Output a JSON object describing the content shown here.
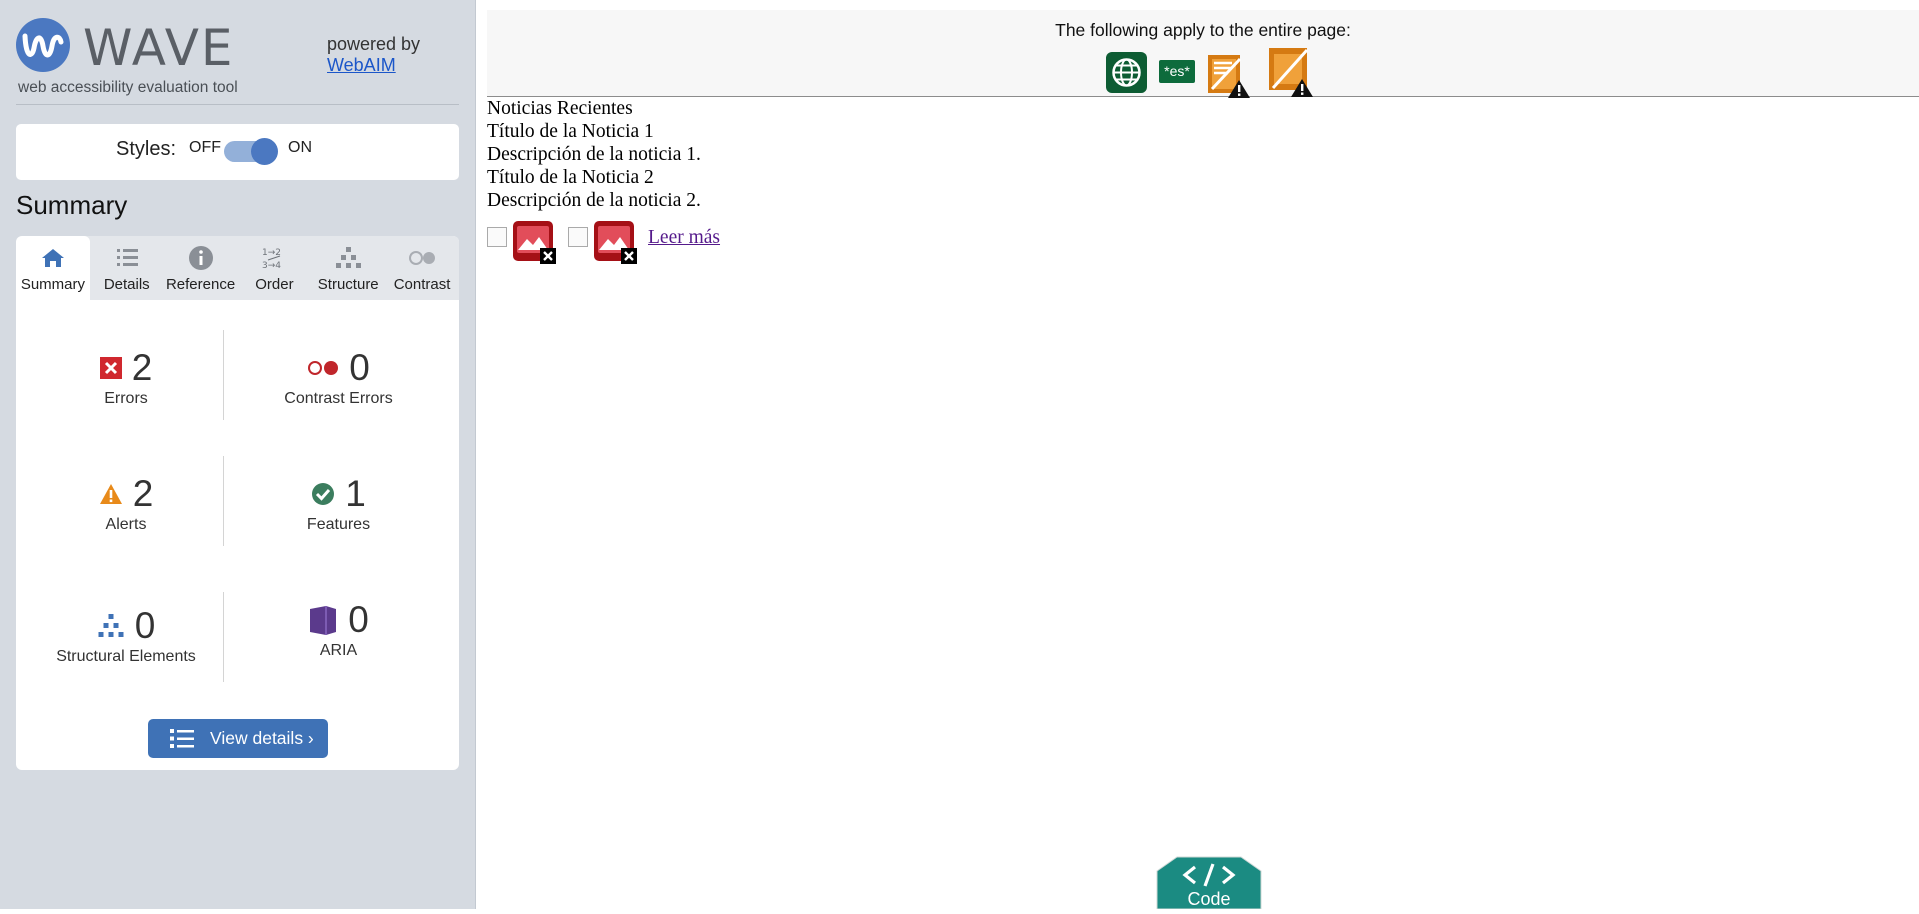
{
  "wave": {
    "brand": "WAVE",
    "tagline": "web accessibility evaluation tool",
    "powered_by": "powered by",
    "webaim_link": "WebAIM"
  },
  "styles_toggle": {
    "label": "Styles:",
    "off": "OFF",
    "on": "ON",
    "state": "ON"
  },
  "summary_heading": "Summary",
  "tabs": [
    {
      "label": "Summary",
      "icon": "home-icon",
      "active": true
    },
    {
      "label": "Details",
      "icon": "list-icon",
      "active": false
    },
    {
      "label": "Reference",
      "icon": "info-icon",
      "active": false
    },
    {
      "label": "Order",
      "icon": "order-icon",
      "active": false
    },
    {
      "label": "Structure",
      "icon": "structure-icon",
      "active": false
    },
    {
      "label": "Contrast",
      "icon": "contrast-icon",
      "active": false
    }
  ],
  "stats": {
    "errors": {
      "count": "2",
      "label": "Errors",
      "icon": "error-icon",
      "color": "#d0282e"
    },
    "contrast_errors": {
      "count": "0",
      "label": "Contrast Errors",
      "icon": "contrast-error-icon",
      "color": "#c0262b"
    },
    "alerts": {
      "count": "2",
      "label": "Alerts",
      "icon": "alert-icon",
      "color": "#e88a1a"
    },
    "features": {
      "count": "1",
      "label": "Features",
      "icon": "feature-icon",
      "color": "#3b7d5e"
    },
    "structural": {
      "count": "0",
      "label": "Structural Elements",
      "icon": "structure-icon",
      "color": "#3f72b6"
    },
    "aria": {
      "count": "0",
      "label": "ARIA",
      "icon": "aria-icon",
      "color": "#5b3a8c"
    }
  },
  "view_details_label": "View details ›",
  "page_bar": {
    "text": "The following apply to the entire page:",
    "icons": [
      "language-icon",
      "lang-es-icon",
      "alert-page-icon",
      "alert-title-icon"
    ],
    "lang_code": "*es*"
  },
  "page_content": {
    "lines": [
      "Noticias Recientes",
      "Título de la Noticia 1",
      "Descripción de la noticia 1.",
      "Título de la Noticia 2",
      "Descripción de la noticia 2."
    ],
    "link": "Leer más"
  },
  "code_button": "Code",
  "colors": {
    "wave_blue": "#4b78c1",
    "sidebar_bg": "#d5dae1",
    "code_teal": "#1b8b82",
    "feature_green": "#0d5c33",
    "alert_orange": "#d57a12"
  }
}
